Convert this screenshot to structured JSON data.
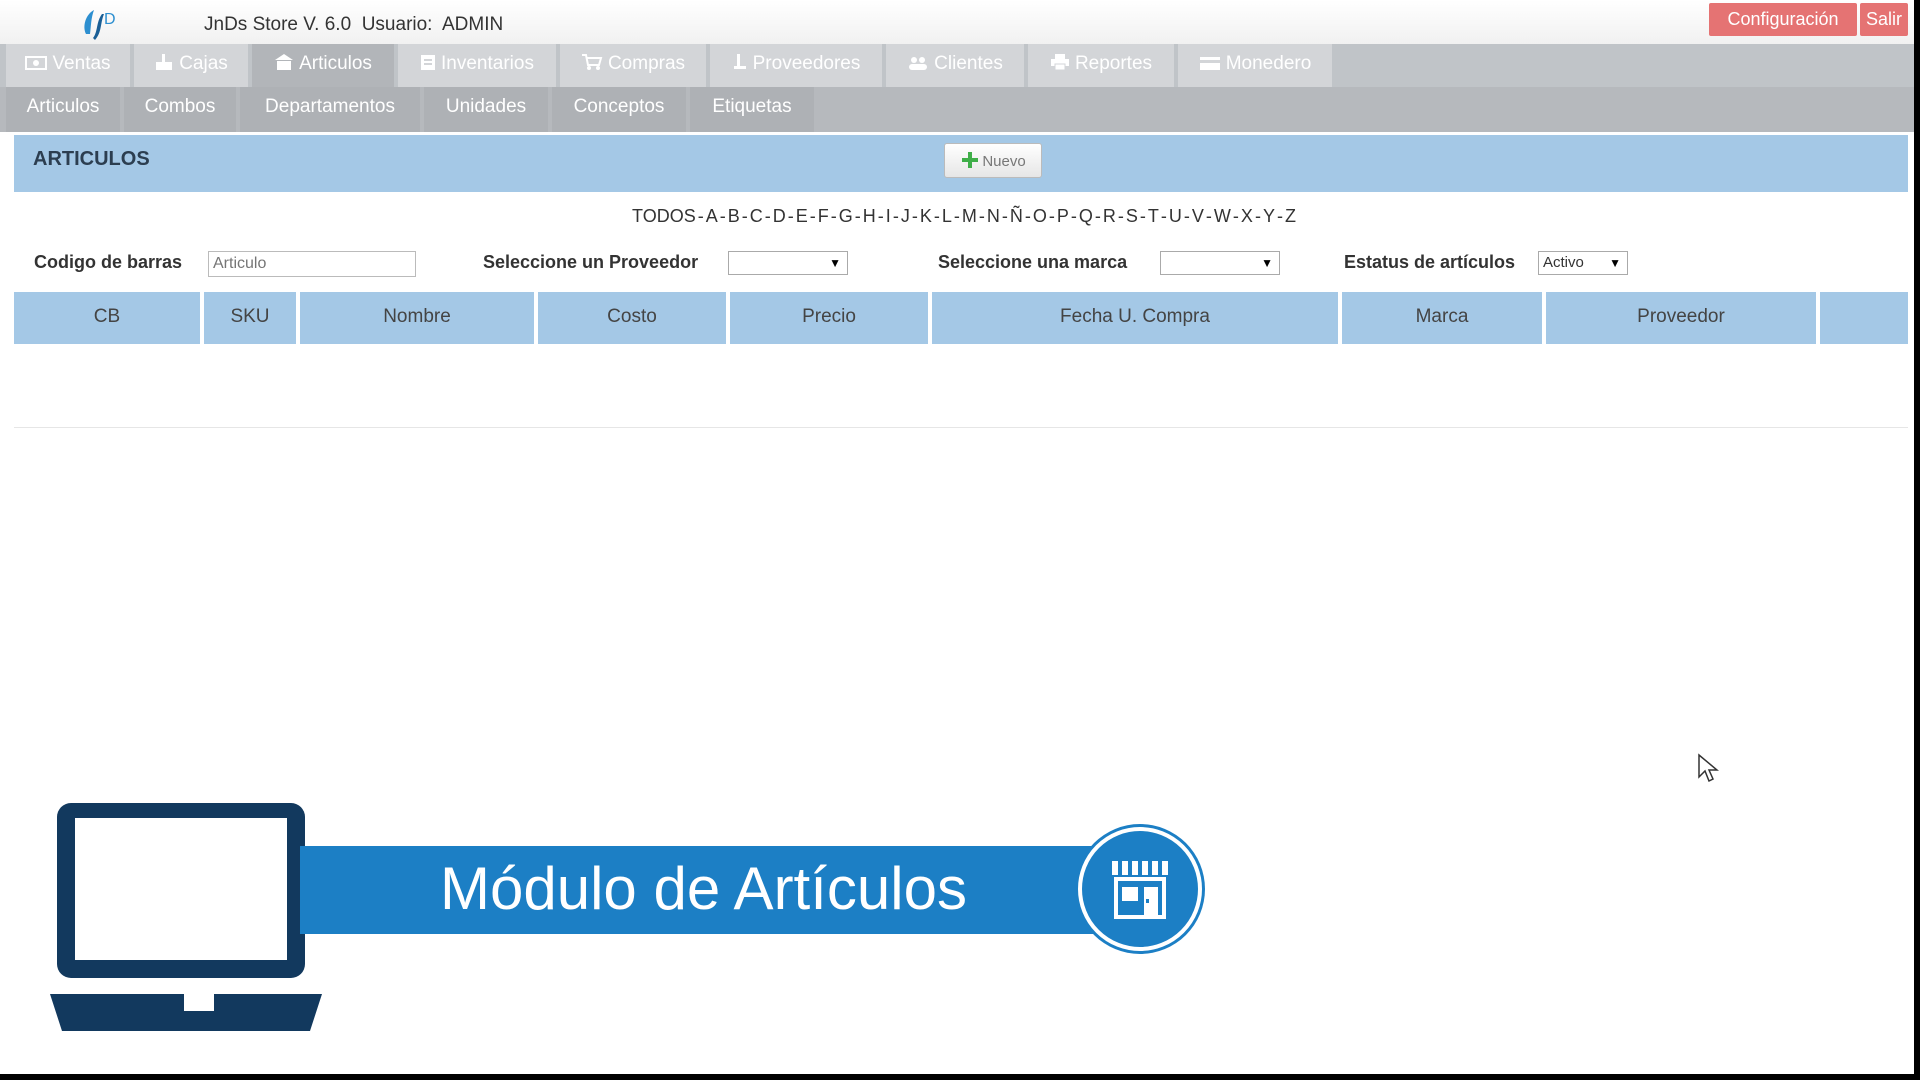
{
  "header": {
    "title": "JnDs Store V. 6.0  Usuario:  ADMIN",
    "config_label": "Configuración",
    "exit_label": "Salir"
  },
  "main_nav": [
    {
      "label": "Ventas",
      "icon": "money-icon"
    },
    {
      "label": "Cajas",
      "icon": "cash-register-icon"
    },
    {
      "label": "Articulos",
      "icon": "store-icon",
      "active": true
    },
    {
      "label": "Inventarios",
      "icon": "clipboard-icon"
    },
    {
      "label": "Compras",
      "icon": "cart-icon"
    },
    {
      "label": "Proveedores",
      "icon": "dolly-icon"
    },
    {
      "label": "Clientes",
      "icon": "users-icon"
    },
    {
      "label": "Reportes",
      "icon": "printer-icon"
    },
    {
      "label": "Monedero",
      "icon": "wallet-icon"
    }
  ],
  "sub_nav": [
    "Articulos",
    "Combos",
    "Departamentos",
    "Unidades",
    "Conceptos",
    "Etiquetas"
  ],
  "panel": {
    "title": "ARTICULOS",
    "new_label": "Nuevo"
  },
  "alpha_filter": [
    "TODOS",
    "A",
    "B",
    "C",
    "D",
    "E",
    "F",
    "G",
    "H",
    "I",
    "J",
    "K",
    "L",
    "M",
    "N",
    "Ñ",
    "O",
    "P",
    "Q",
    "R",
    "S",
    "T",
    "U",
    "V",
    "W",
    "X",
    "Y",
    "Z"
  ],
  "filters": {
    "barcode_label": "Codigo de barras",
    "barcode_placeholder": "Articulo",
    "provider_label": "Seleccione un Proveedor",
    "provider_value": "",
    "brand_label": "Seleccione una marca",
    "brand_value": "",
    "status_label": "Estatus de artículos",
    "status_value": "Activo"
  },
  "table": {
    "columns": [
      "CB",
      "SKU",
      "Nombre",
      "Costo",
      "Precio",
      "Fecha U. Compra",
      "Marca",
      "Proveedor",
      ""
    ]
  },
  "banner": {
    "title": "Módulo de Artículos"
  },
  "colors": {
    "accent_blue": "#1c7fc5",
    "panel_blue": "#a4c8e6",
    "danger": "#e57373",
    "nav_gray": "#d3d5d8"
  }
}
